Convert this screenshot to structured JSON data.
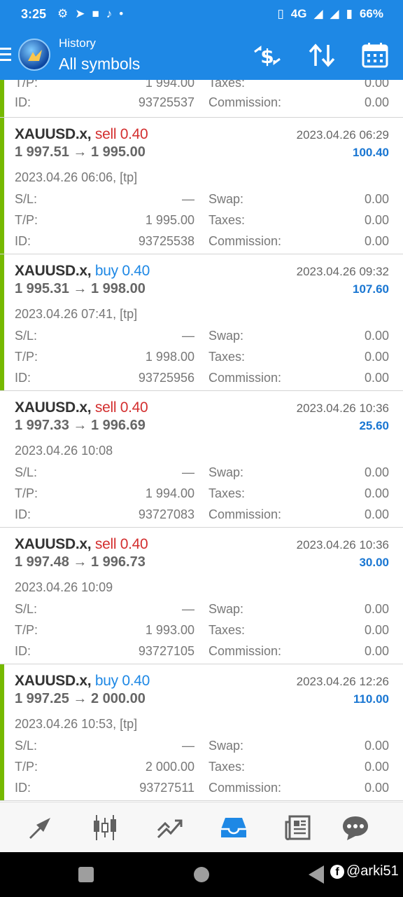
{
  "status_bar": {
    "time": "3:25",
    "network": "4G",
    "battery": "66%"
  },
  "header": {
    "subtitle": "History",
    "title": "All symbols"
  },
  "partial_deal": {
    "tp_value": "1 994.00",
    "taxes_label": "Taxes:",
    "taxes_value": "0.00",
    "id_label": "ID:",
    "id_value": "93725537",
    "commission_label": "Commission:",
    "commission_value": "0.00"
  },
  "labels": {
    "sl": "S/L:",
    "tp": "T/P:",
    "id": "ID:",
    "swap": "Swap:",
    "taxes": "Taxes:",
    "commission": "Commission:",
    "tp_short": "T/P:"
  },
  "deals": [
    {
      "symbol": "XAUUSD.x,",
      "type": "sell",
      "volume": "0.40",
      "prices": "1 997.51 → 1 995.00",
      "close_time": "2023.04.26 06:29",
      "profit": "100.40",
      "open_time": "2023.04.26 06:06, [tp]",
      "sl": "—",
      "tp": "1 995.00",
      "id": "93725538",
      "swap": "0.00",
      "taxes": "0.00",
      "commission": "0.00",
      "marker": "green"
    },
    {
      "symbol": "XAUUSD.x,",
      "type": "buy",
      "volume": "0.40",
      "prices": "1 995.31 → 1 998.00",
      "close_time": "2023.04.26 09:32",
      "profit": "107.60",
      "open_time": "2023.04.26 07:41, [tp]",
      "sl": "—",
      "tp": "1 998.00",
      "id": "93725956",
      "swap": "0.00",
      "taxes": "0.00",
      "commission": "0.00",
      "marker": "green"
    },
    {
      "symbol": "XAUUSD.x,",
      "type": "sell",
      "volume": "0.40",
      "prices": "1 997.33 → 1 996.69",
      "close_time": "2023.04.26 10:36",
      "profit": "25.60",
      "open_time": "2023.04.26 10:08",
      "sl": "—",
      "tp": "1 994.00",
      "id": "93727083",
      "swap": "0.00",
      "taxes": "0.00",
      "commission": "0.00",
      "marker": "none"
    },
    {
      "symbol": "XAUUSD.x,",
      "type": "sell",
      "volume": "0.40",
      "prices": "1 997.48 → 1 996.73",
      "close_time": "2023.04.26 10:36",
      "profit": "30.00",
      "open_time": "2023.04.26 10:09",
      "sl": "—",
      "tp": "1 993.00",
      "id": "93727105",
      "swap": "0.00",
      "taxes": "0.00",
      "commission": "0.00",
      "marker": "none"
    },
    {
      "symbol": "XAUUSD.x,",
      "type": "buy",
      "volume": "0.40",
      "prices": "1 997.25 → 2 000.00",
      "close_time": "2023.04.26 12:26",
      "profit": "110.00",
      "open_time": "2023.04.26 10:53, [tp]",
      "sl": "—",
      "tp": "2 000.00",
      "id": "93727511",
      "swap": "0.00",
      "taxes": "0.00",
      "commission": "0.00",
      "marker": "green"
    }
  ],
  "bottom_nav": [
    {
      "icon": "trade-icon"
    },
    {
      "icon": "chart-candles-icon"
    },
    {
      "icon": "trend-icon"
    },
    {
      "icon": "history-inbox-icon",
      "active": true
    },
    {
      "icon": "news-icon"
    },
    {
      "icon": "chat-icon"
    }
  ],
  "watermark": "@arki51",
  "colors": {
    "accent": "#1e88e5",
    "sell": "#d32f2f",
    "buy": "#1e88e5",
    "profit": "#1976d2",
    "marker": "#76b900"
  }
}
